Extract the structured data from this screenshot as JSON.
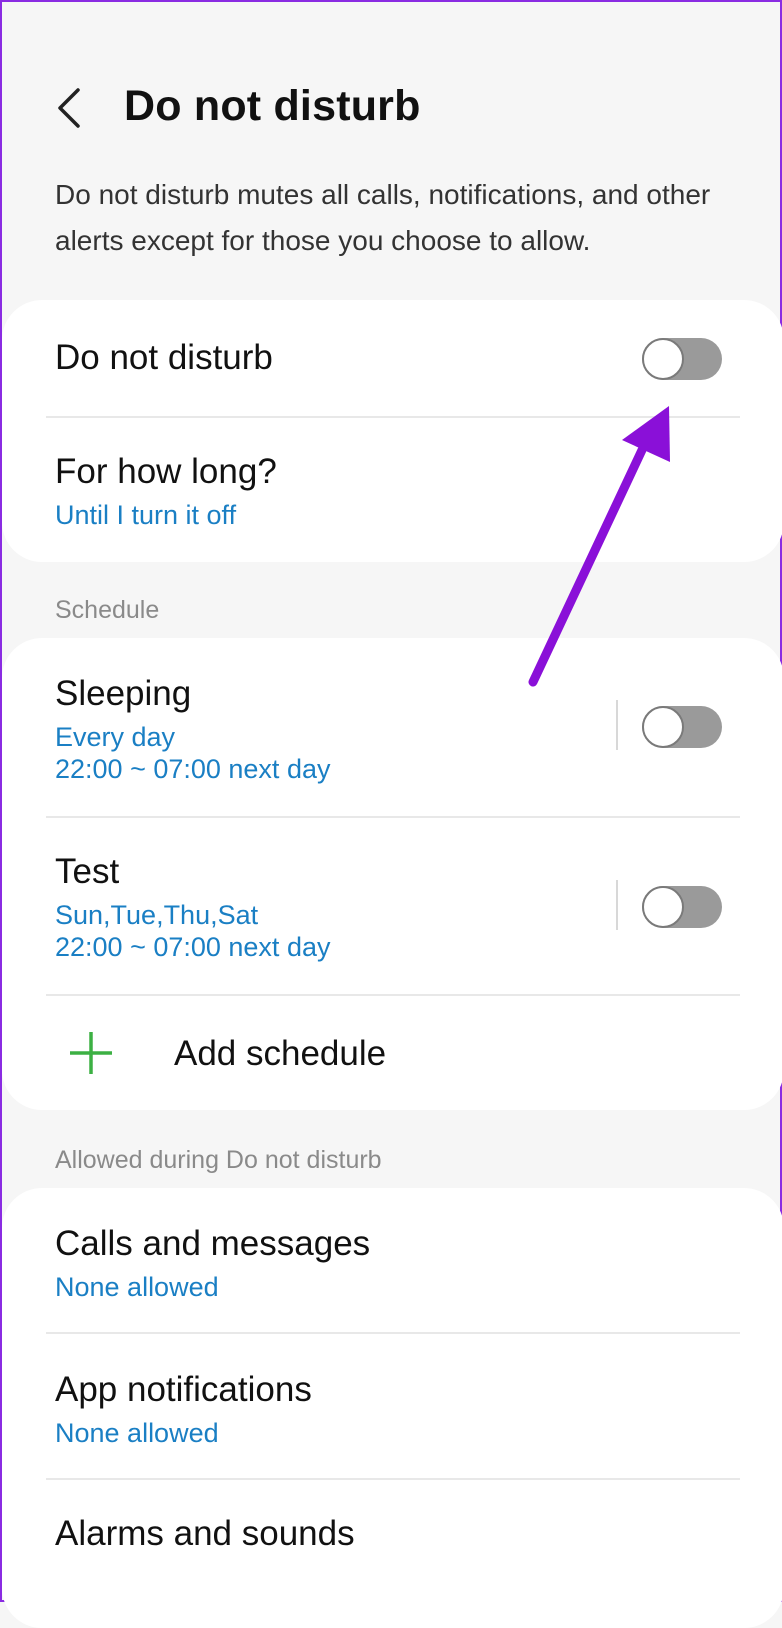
{
  "header": {
    "title": "Do not disturb"
  },
  "description": "Do not disturb mutes all calls, notifications, and other alerts except for those you choose to allow.",
  "main_card": {
    "dnd_label": "Do not disturb",
    "dnd_enabled": false,
    "duration_label": "For how long?",
    "duration_value": "Until I turn it off"
  },
  "schedule": {
    "section_label": "Schedule",
    "items": [
      {
        "title": "Sleeping",
        "days": "Every day",
        "time": "22:00 ~ 07:00 next day",
        "enabled": false
      },
      {
        "title": "Test",
        "days": "Sun,Tue,Thu,Sat",
        "time": "22:00 ~ 07:00 next day",
        "enabled": false
      }
    ],
    "add_label": "Add schedule"
  },
  "allowed": {
    "section_label": "Allowed during Do not disturb",
    "items": [
      {
        "title": "Calls and messages",
        "value": "None allowed"
      },
      {
        "title": "App notifications",
        "value": "None allowed"
      },
      {
        "title": "Alarms and sounds",
        "value": ""
      }
    ]
  },
  "colors": {
    "accent_link": "#1a7fc4",
    "toggle_off": "#9a9a9a",
    "plus_green": "#3cb043",
    "annotation_arrow": "#8a10d8"
  }
}
